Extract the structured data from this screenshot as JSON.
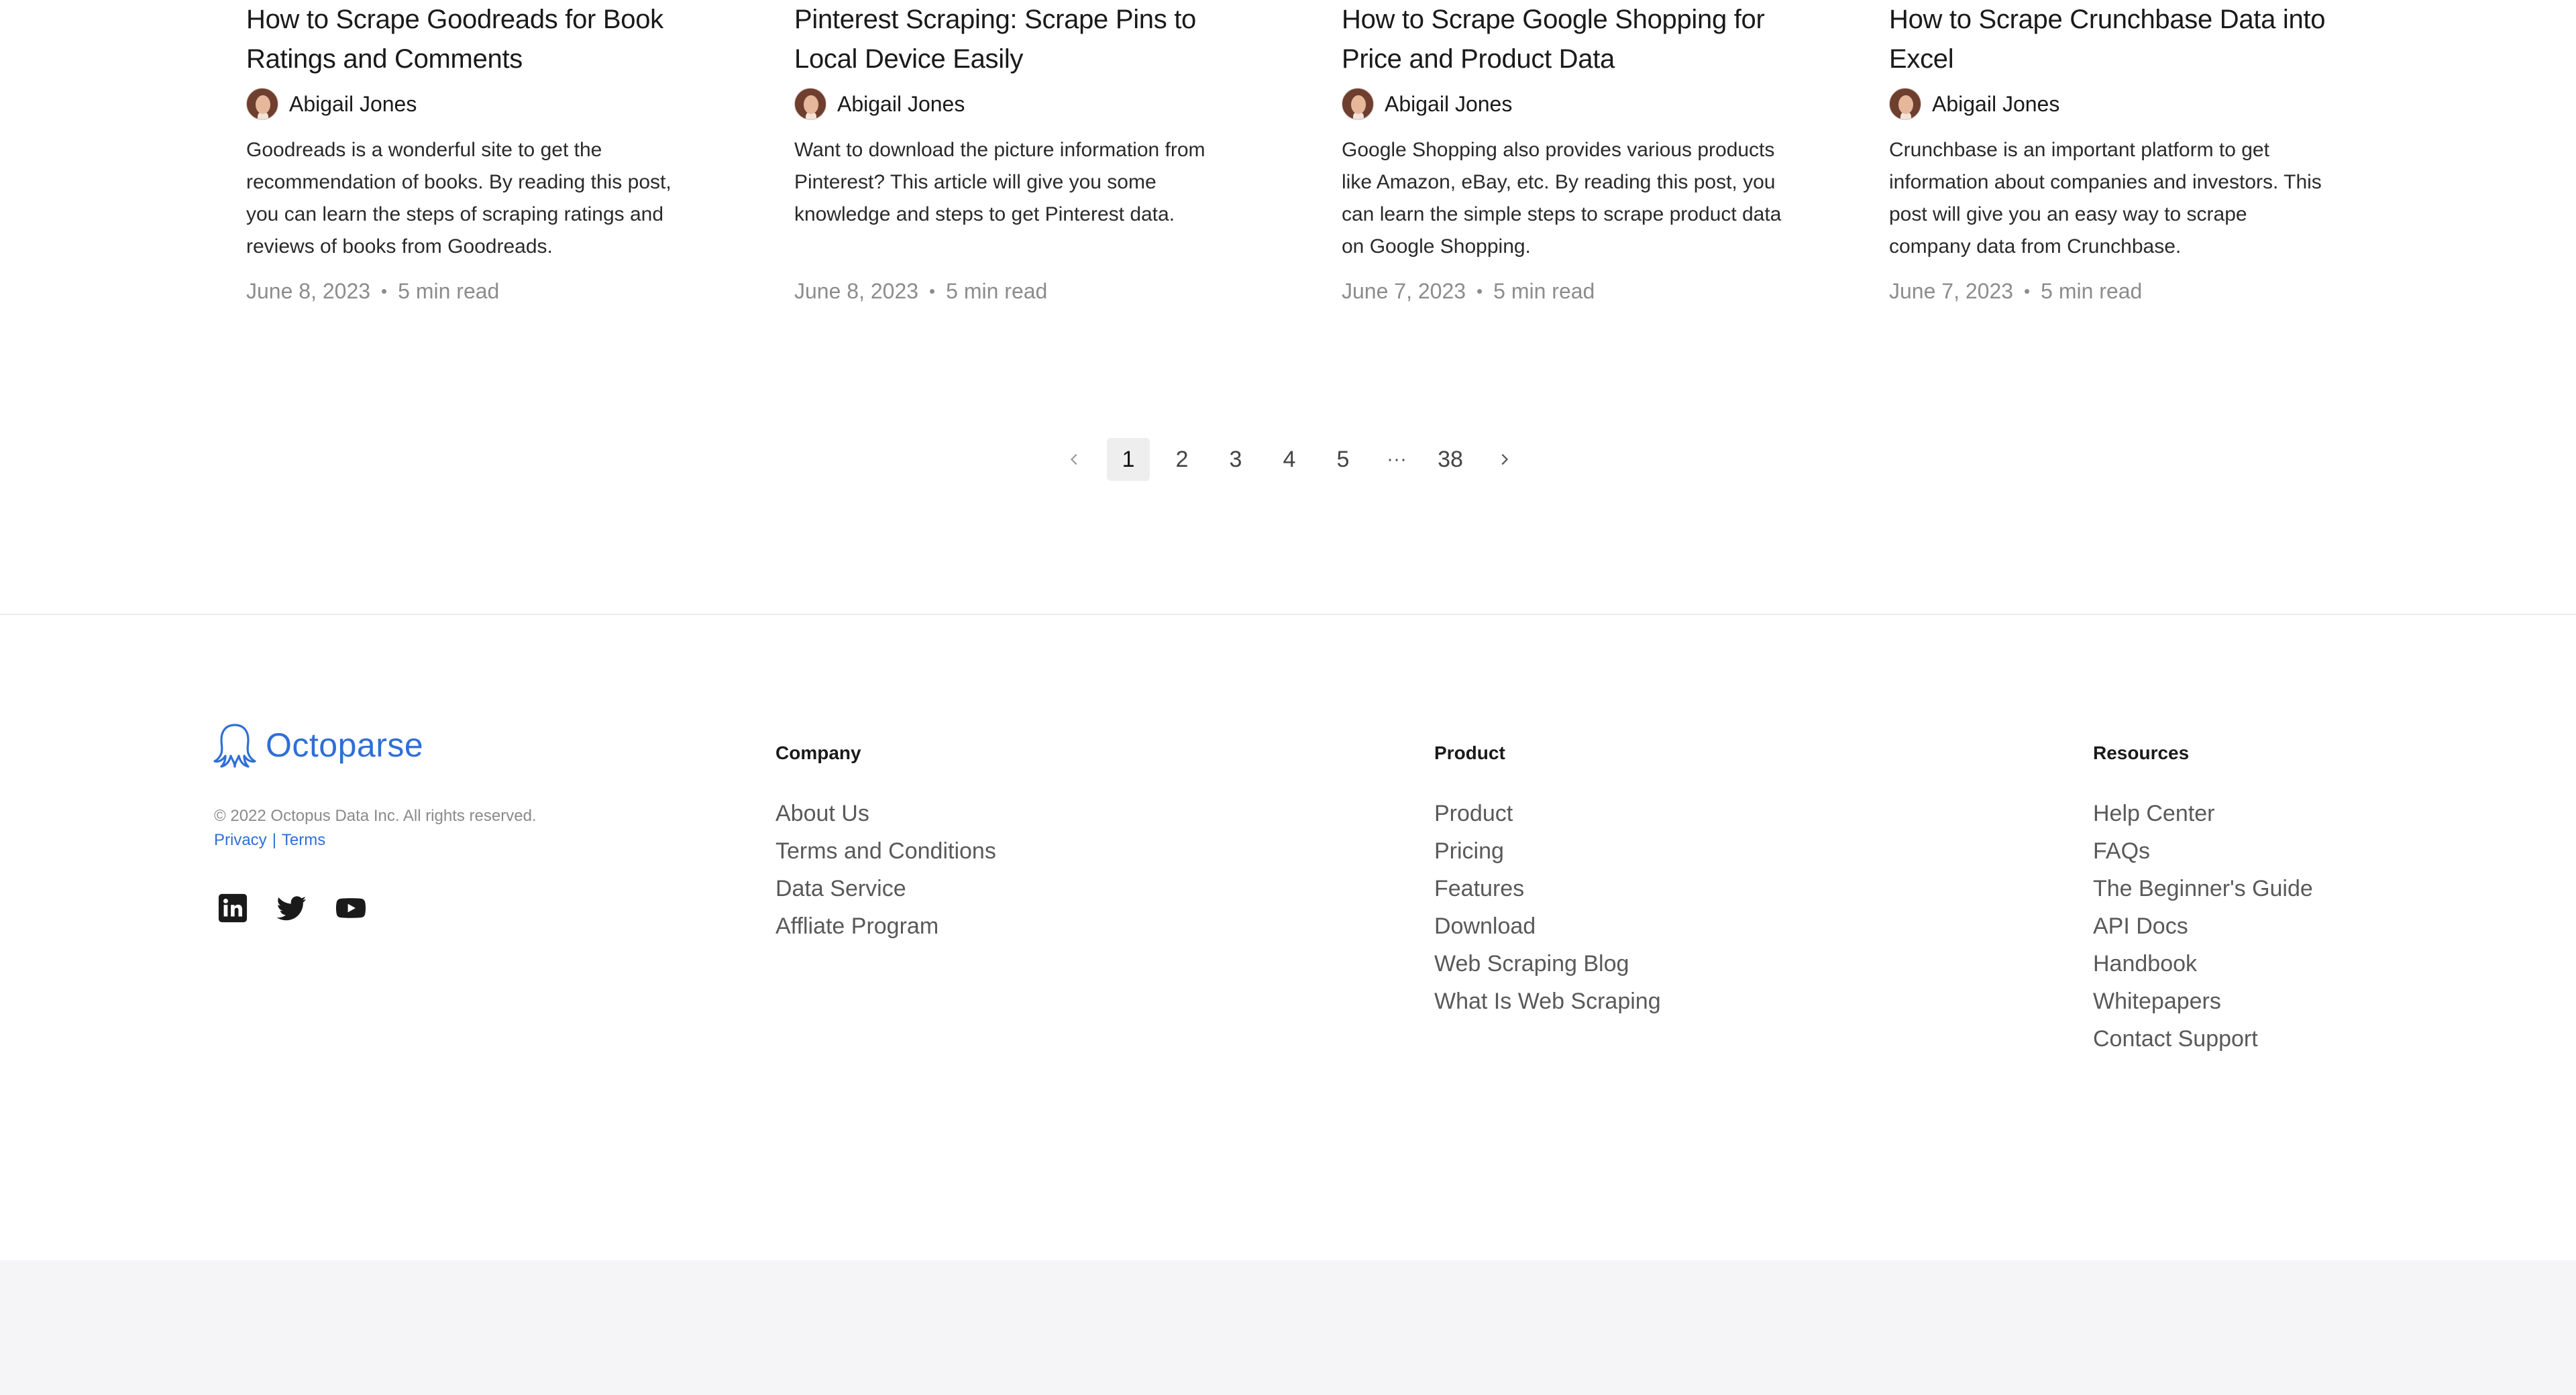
{
  "articles": [
    {
      "title": "How to Scrape Goodreads for Book Ratings and Comments",
      "author": "Abigail Jones",
      "excerpt": "Goodreads is a wonderful site to get the recommendation of books. By reading this post, you can learn the steps of scraping ratings and reviews of books from Goodreads.",
      "date": "June 8, 2023",
      "read_time": "5 min read"
    },
    {
      "title": "Pinterest Scraping: Scrape Pins to Local Device Easily",
      "author": "Abigail Jones",
      "excerpt": "Want to download the picture information from Pinterest? This article will give you some knowledge and steps to get Pinterest data.",
      "date": "June 8, 2023",
      "read_time": "5 min read"
    },
    {
      "title": "How to Scrape Google Shopping for Price and Product Data",
      "author": "Abigail Jones",
      "excerpt": "Google Shopping also provides various products like Amazon, eBay, etc. By reading this post, you can learn the simple steps to scrape product data on Google Shopping.",
      "date": "June 7, 2023",
      "read_time": "5 min read"
    },
    {
      "title": "How to Scrape Crunchbase Data into Excel",
      "author": "Abigail Jones",
      "excerpt": "Crunchbase is an important platform to get information about companies and investors. This post will give you an easy way to scrape company data from Crunchbase.",
      "date": "June 7, 2023",
      "read_time": "5 min read"
    }
  ],
  "meta_separator": "•",
  "pagination": {
    "prev_icon": "chevron-left-icon",
    "next_icon": "chevron-right-icon",
    "pages": [
      "1",
      "2",
      "3",
      "4",
      "5"
    ],
    "ellipsis": "···",
    "last_page": "38",
    "current": "1"
  },
  "footer": {
    "brand": {
      "name": "Octoparse",
      "icon": "octopus-logo-icon",
      "color": "#2f6fd6"
    },
    "copyright": "© 2022 Octopus Data Inc. All rights reserved.",
    "privacy_label": "Privacy",
    "legal_separator": "|",
    "terms_label": "Terms",
    "social_icons": [
      "linkedin-icon",
      "twitter-icon",
      "youtube-icon"
    ],
    "columns": {
      "company": {
        "heading": "Company",
        "links": [
          "About Us",
          "Terms and Conditions",
          "Data Service",
          "Affliate Program"
        ]
      },
      "product": {
        "heading": "Product",
        "links": [
          "Product",
          "Pricing",
          "Features",
          "Download",
          "Web Scraping Blog",
          "What Is Web Scraping"
        ]
      },
      "resources": {
        "heading": "Resources",
        "links": [
          "Help Center",
          "FAQs",
          "The Beginner's Guide",
          "API Docs",
          "Handbook",
          "Whitepapers",
          "Contact Support"
        ]
      }
    }
  }
}
